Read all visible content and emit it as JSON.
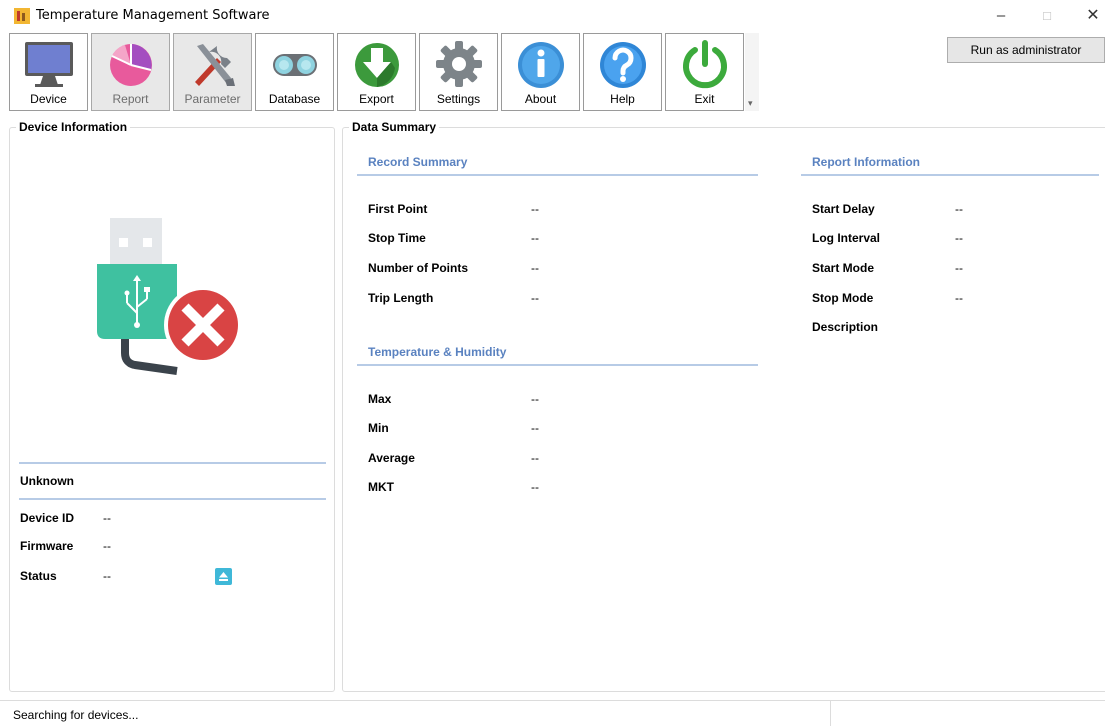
{
  "window": {
    "title": "Temperature Management Software",
    "minimize_glyph": "–",
    "maximize_glyph": "□",
    "close_glyph": "✕"
  },
  "toolbar": {
    "items": [
      {
        "label": "Device",
        "icon": "monitor-icon",
        "state": "normal"
      },
      {
        "label": "Report",
        "icon": "pie-chart-icon",
        "state": "disabled"
      },
      {
        "label": "Parameter",
        "icon": "tools-icon",
        "state": "disabled"
      },
      {
        "label": "Database",
        "icon": "binoculars-icon",
        "state": "normal"
      },
      {
        "label": "Export",
        "icon": "export-icon",
        "state": "normal"
      },
      {
        "label": "Settings",
        "icon": "gear-icon",
        "state": "normal"
      },
      {
        "label": "About",
        "icon": "info-icon",
        "state": "normal"
      },
      {
        "label": "Help",
        "icon": "help-icon",
        "state": "normal"
      },
      {
        "label": "Exit",
        "icon": "power-icon",
        "state": "normal"
      }
    ],
    "overflow_glyph": "▾",
    "run_as_admin": "Run as administrator"
  },
  "device_info": {
    "title": "Device Information",
    "illustration": "usb-disconnected-icon",
    "name": "Unknown",
    "fields": [
      {
        "label": "Device ID",
        "value": "--"
      },
      {
        "label": "Firmware",
        "value": "--"
      },
      {
        "label": "Status",
        "value": "--"
      }
    ],
    "eject_icon": "eject-icon"
  },
  "data_summary": {
    "title": "Data Summary",
    "record_summary": {
      "title": "Record Summary",
      "fields": [
        {
          "label": "First Point",
          "value": "--"
        },
        {
          "label": "Stop Time",
          "value": "--"
        },
        {
          "label": "Number of Points",
          "value": "--"
        },
        {
          "label": "Trip Length",
          "value": "--"
        }
      ]
    },
    "temp_humidity": {
      "title": "Temperature & Humidity",
      "fields": [
        {
          "label": "Max",
          "value": "--"
        },
        {
          "label": "Min",
          "value": "--"
        },
        {
          "label": "Average",
          "value": "--"
        },
        {
          "label": "MKT",
          "value": "--"
        }
      ]
    },
    "report_info": {
      "title": "Report Information",
      "fields": [
        {
          "label": "Start Delay",
          "value": "--"
        },
        {
          "label": "Log Interval",
          "value": "--"
        },
        {
          "label": "Start Mode",
          "value": "--"
        },
        {
          "label": "Stop Mode",
          "value": "--"
        },
        {
          "label": "Description",
          "value": ""
        }
      ]
    }
  },
  "statusbar": {
    "text": "Searching for devices..."
  },
  "colors": {
    "section_title": "#5a82c0",
    "separator": "#b7cbe6",
    "eject": "#3fb8d8"
  }
}
